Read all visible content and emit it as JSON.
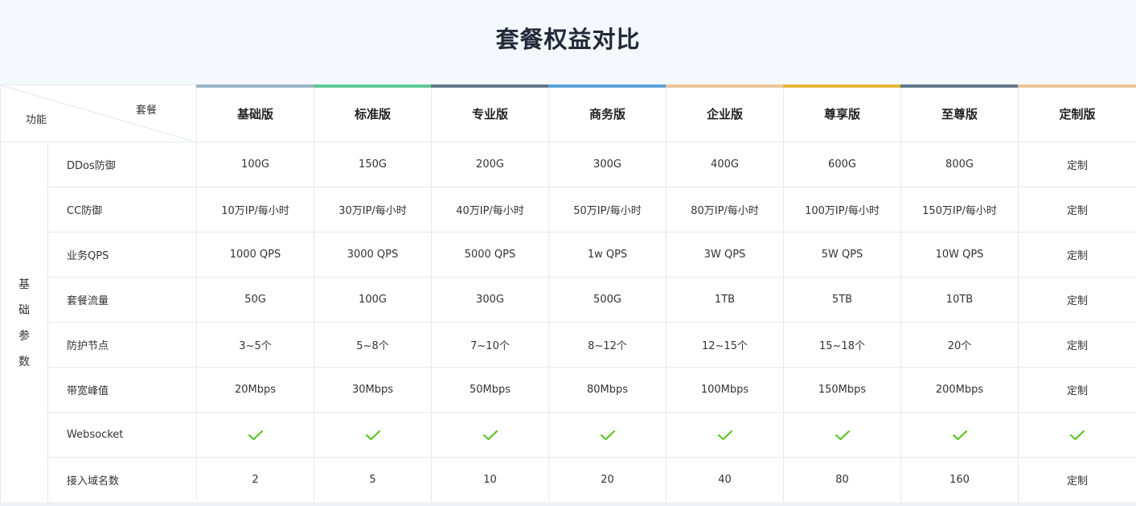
{
  "title": "套餐权益对比",
  "corner": {
    "feature_label": "功能",
    "plan_label": "套餐"
  },
  "plans": [
    {
      "name": "基础版",
      "color": "#9cb5c8"
    },
    {
      "name": "标准版",
      "color": "#5ecb94"
    },
    {
      "name": "专业版",
      "color": "#607889"
    },
    {
      "name": "商务版",
      "color": "#5da0dc"
    },
    {
      "name": "企业版",
      "color": "#ecc49a"
    },
    {
      "name": "尊享版",
      "color": "#e8b83a"
    },
    {
      "name": "至尊版",
      "color": "#607889"
    },
    {
      "name": "定制版",
      "color": "#ecc49a"
    }
  ],
  "group_label": [
    "基",
    "础",
    "参",
    "数"
  ],
  "check_color": "#52c41a",
  "rows": [
    {
      "feature": "DDos防御",
      "values": [
        "100G",
        "150G",
        "200G",
        "300G",
        "400G",
        "600G",
        "800G",
        "定制"
      ]
    },
    {
      "feature": "CC防御",
      "values": [
        "10万IP/每小时",
        "30万IP/每小时",
        "40万IP/每小时",
        "50万IP/每小时",
        "80万IP/每小时",
        "100万IP/每小时",
        "150万IP/每小时",
        "定制"
      ]
    },
    {
      "feature": "业务QPS",
      "values": [
        "1000 QPS",
        "3000 QPS",
        "5000 QPS",
        "1w QPS",
        "3W QPS",
        "5W QPS",
        "10W QPS",
        "定制"
      ]
    },
    {
      "feature": "套餐流量",
      "values": [
        "50G",
        "100G",
        "300G",
        "500G",
        "1TB",
        "5TB",
        "10TB",
        "定制"
      ]
    },
    {
      "feature": "防护节点",
      "values": [
        "3~5个",
        "5~8个",
        "7~10个",
        "8~12个",
        "12~15个",
        "15~18个",
        "20个",
        "定制"
      ]
    },
    {
      "feature": "带宽峰值",
      "values": [
        "20Mbps",
        "30Mbps",
        "50Mbps",
        "80Mbps",
        "100Mbps",
        "150Mbps",
        "200Mbps",
        "定制"
      ]
    },
    {
      "feature": "Websocket",
      "values": [
        "✓",
        "✓",
        "✓",
        "✓",
        "✓",
        "✓",
        "✓",
        "✓"
      ]
    },
    {
      "feature": "接入域名数",
      "values": [
        "2",
        "5",
        "10",
        "20",
        "40",
        "80",
        "160",
        "定制"
      ]
    }
  ]
}
